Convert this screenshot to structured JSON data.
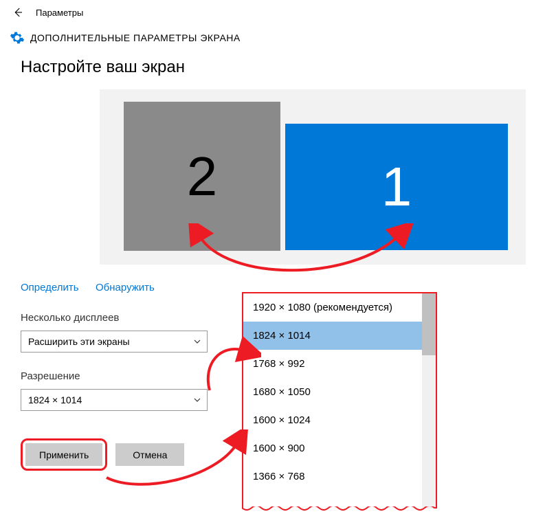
{
  "titlebar": {
    "title": "Параметры"
  },
  "header": {
    "title": "ДОПОЛНИТЕЛЬНЫЕ ПАРАМЕТРЫ ЭКРАНА"
  },
  "section_heading": "Настройте ваш экран",
  "displays": {
    "d2": "2",
    "d1": "1"
  },
  "links": {
    "identify": "Определить",
    "detect": "Обнаружить"
  },
  "multi_display": {
    "label": "Несколько дисплеев",
    "value": "Расширить эти экраны"
  },
  "resolution": {
    "label": "Разрешение",
    "value": "1824 × 1014"
  },
  "buttons": {
    "apply": "Применить",
    "cancel": "Отмена"
  },
  "dropdown": {
    "items": [
      {
        "text": "1920 × 1080 (рекомендуется)",
        "selected": false
      },
      {
        "text": "1824 × 1014",
        "selected": true
      },
      {
        "text": "1768 × 992",
        "selected": false
      },
      {
        "text": "1680 × 1050",
        "selected": false
      },
      {
        "text": "1600 × 1024",
        "selected": false
      },
      {
        "text": "1600 × 900",
        "selected": false
      },
      {
        "text": "1366 × 768",
        "selected": false
      }
    ]
  }
}
